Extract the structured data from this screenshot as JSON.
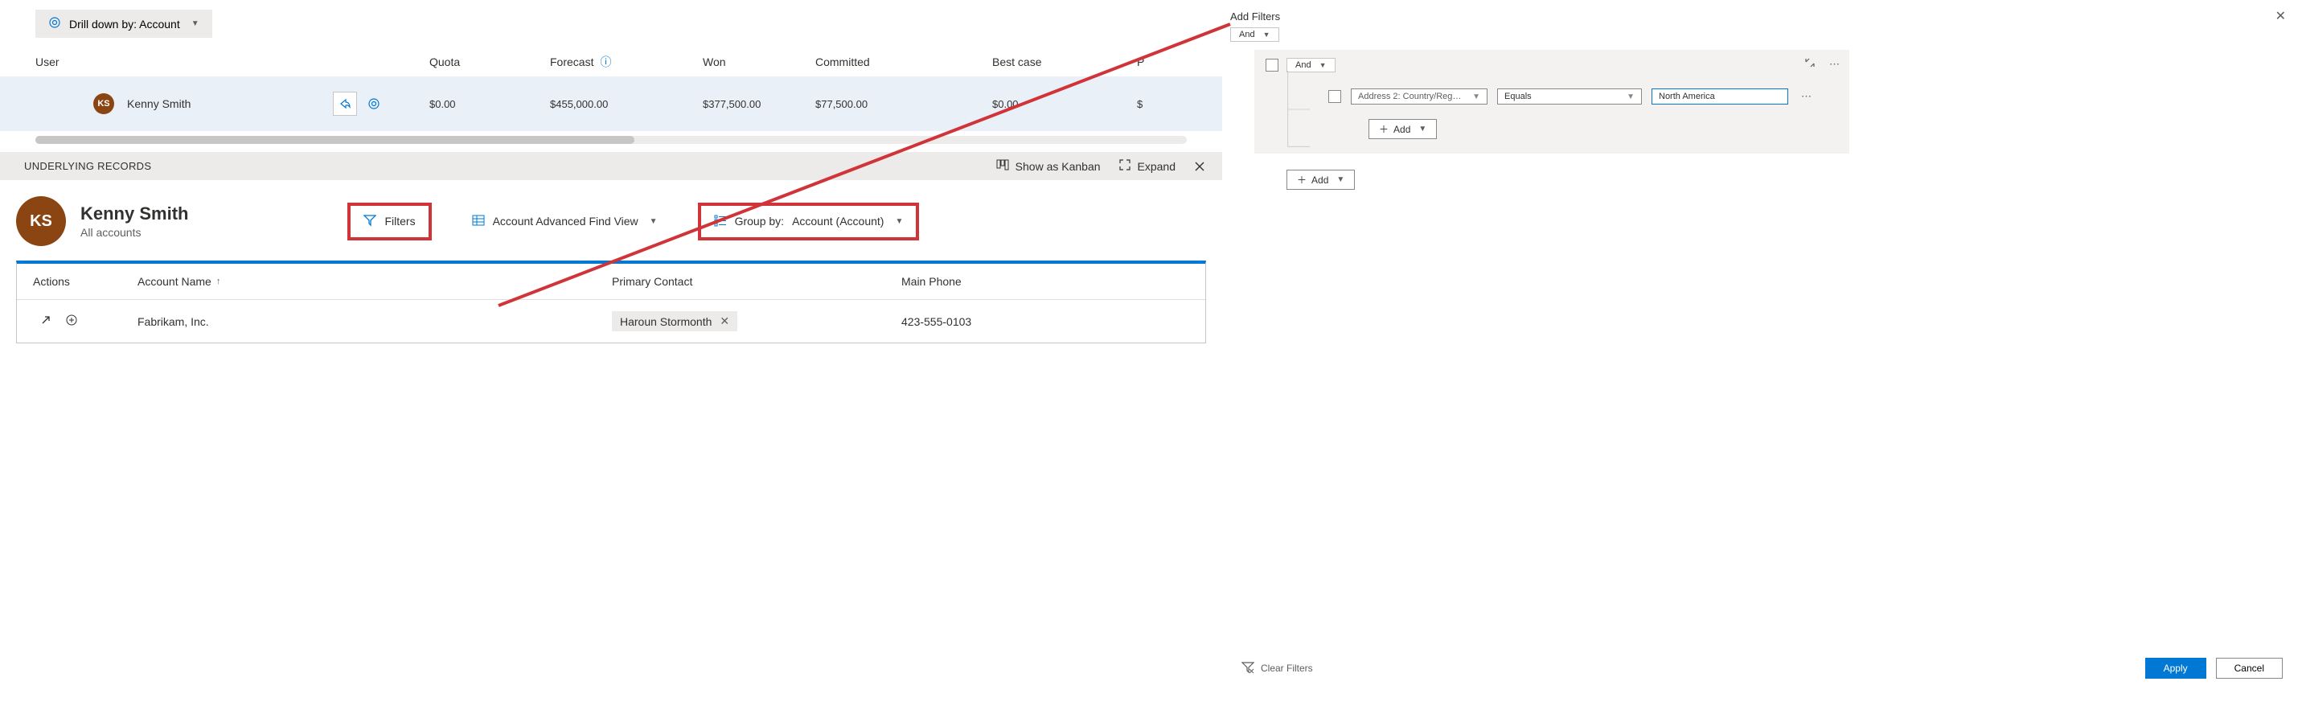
{
  "drill": {
    "label": "Drill down by: Account"
  },
  "forecast": {
    "headers": {
      "user": "User",
      "quota": "Quota",
      "forecast": "Forecast",
      "won": "Won",
      "committed": "Committed",
      "bestcase": "Best case",
      "p": "P"
    },
    "row": {
      "initials": "KS",
      "name": "Kenny Smith",
      "quota": "$0.00",
      "forecast": "$455,000.00",
      "won": "$377,500.00",
      "committed": "$77,500.00",
      "bestcase": "$0.00",
      "p": "$"
    }
  },
  "underlying": {
    "title": "UNDERLYING RECORDS",
    "kanban": "Show as Kanban",
    "expand": "Expand"
  },
  "detail": {
    "initials": "KS",
    "name": "Kenny Smith",
    "sub": "All accounts",
    "filters": "Filters",
    "view": "Account Advanced Find View",
    "groupby_label": "Group by:",
    "groupby_value": "Account (Account)"
  },
  "grid": {
    "headers": {
      "actions": "Actions",
      "name": "Account Name",
      "contact": "Primary Contact",
      "phone": "Main Phone"
    },
    "row": {
      "name": "Fabrikam, Inc.",
      "contact": "Haroun Stormonth",
      "phone": "423-555-0103"
    }
  },
  "addFilters": {
    "title": "Add Filters",
    "outerOp": "And",
    "blockOp": "And",
    "condition": {
      "field": "Address 2: Country/Reg…",
      "operator": "Equals",
      "value": "North America"
    },
    "add": "Add",
    "clear": "Clear Filters",
    "apply": "Apply",
    "cancel": "Cancel"
  }
}
